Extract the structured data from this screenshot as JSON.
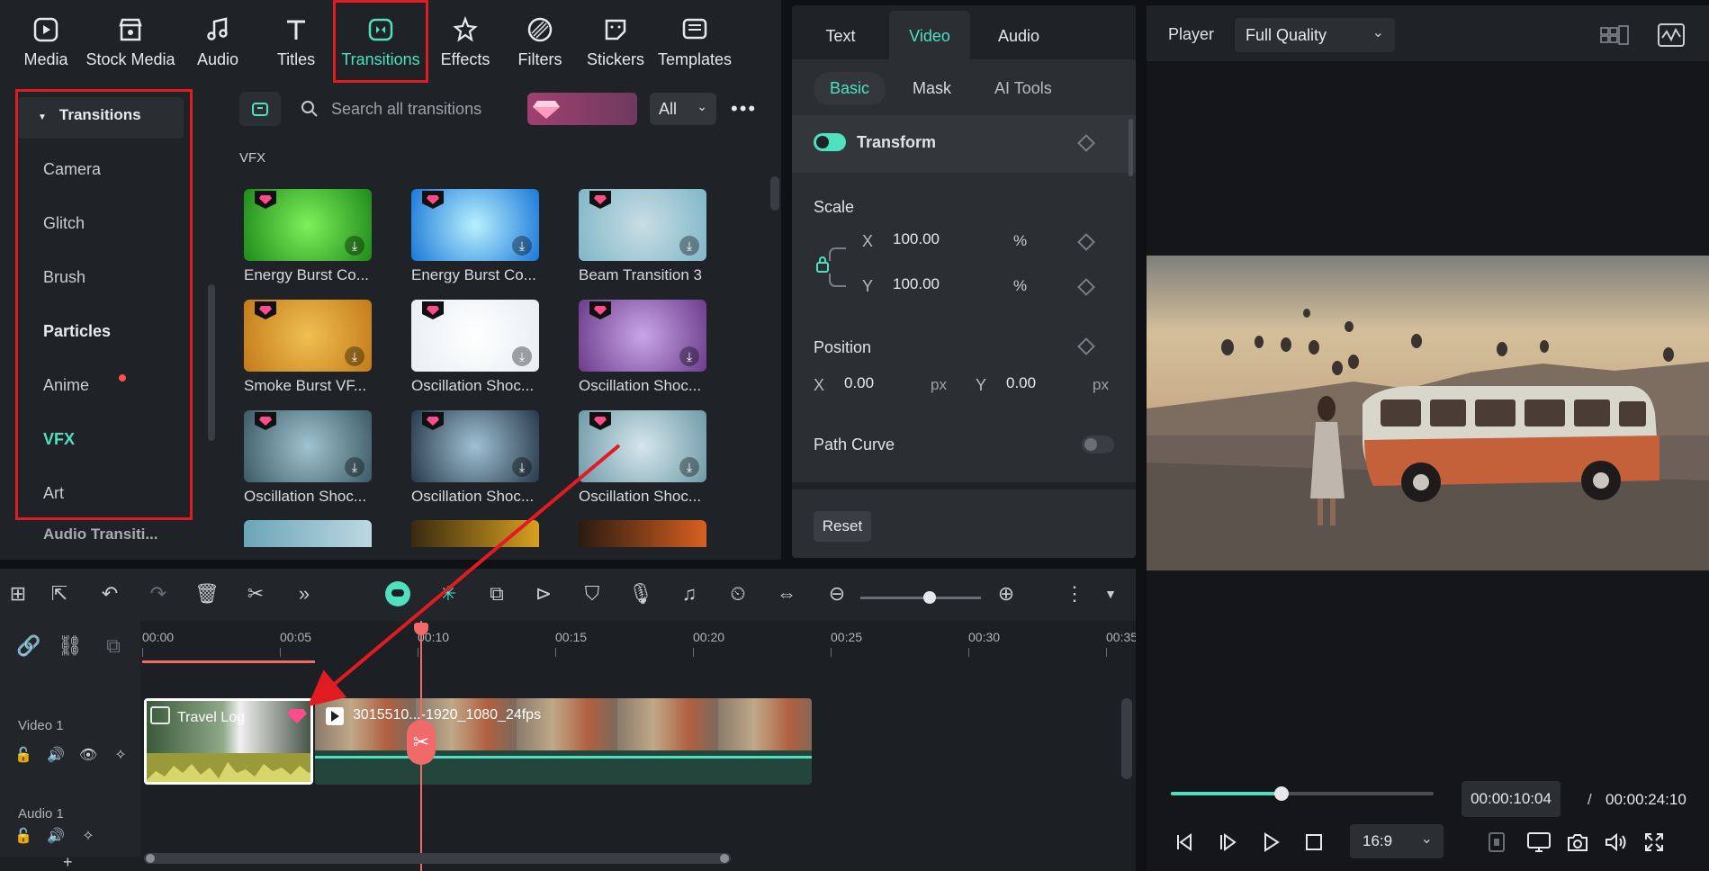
{
  "toolbar": {
    "items": [
      {
        "label": "Media",
        "icon": "media-icon"
      },
      {
        "label": "Stock Media",
        "icon": "stock-media-icon"
      },
      {
        "label": "Audio",
        "icon": "audio-icon"
      },
      {
        "label": "Titles",
        "icon": "titles-icon"
      },
      {
        "label": "Transitions",
        "icon": "transitions-icon"
      },
      {
        "label": "Effects",
        "icon": "effects-icon"
      },
      {
        "label": "Filters",
        "icon": "filters-icon"
      },
      {
        "label": "Stickers",
        "icon": "stickers-icon"
      },
      {
        "label": "Templates",
        "icon": "templates-icon"
      }
    ],
    "active": "Transitions"
  },
  "categories": {
    "header": "Transitions",
    "items": [
      "Camera",
      "Glitch",
      "Brush",
      "Particles",
      "Anime",
      "VFX",
      "Art"
    ],
    "footer": "Audio Transiti..."
  },
  "search": {
    "placeholder": "Search all transitions",
    "filter": "All"
  },
  "section_title": "VFX",
  "thumbnails": [
    {
      "label": "Energy Burst Co...",
      "colors": [
        "#1e8a1a",
        "#7ef05a"
      ]
    },
    {
      "label": "Energy Burst Co...",
      "colors": [
        "#1a78d8",
        "#b8f0ff"
      ]
    },
    {
      "label": "Beam Transition 3",
      "colors": [
        "#7fb7c9",
        "#c9dde4"
      ]
    },
    {
      "label": "Smoke Burst VF...",
      "colors": [
        "#c47a1a",
        "#f0c050"
      ]
    },
    {
      "label": "Oscillation Shoc...",
      "colors": [
        "#e8eef2",
        "#ffffff"
      ]
    },
    {
      "label": "Oscillation Shoc...",
      "colors": [
        "#6b3c8a",
        "#c9a5e8"
      ]
    },
    {
      "label": "Oscillation Shoc...",
      "colors": [
        "#3c5a66",
        "#9fc4cf"
      ]
    },
    {
      "label": "Oscillation Shoc...",
      "colors": [
        "#263a4a",
        "#a0c0d4"
      ]
    },
    {
      "label": "Oscillation Shoc...",
      "colors": [
        "#6f9aa8",
        "#d5e6ec"
      ]
    }
  ],
  "properties": {
    "tabs": [
      "Text",
      "Video",
      "Audio"
    ],
    "active_tab": "Video",
    "subtabs": [
      "Basic",
      "Mask",
      "AI Tools"
    ],
    "active_subtab": "Basic",
    "transform_label": "Transform",
    "scale_label": "Scale",
    "scale_x": "100.00",
    "scale_y": "100.00",
    "x_label": "X",
    "y_label": "Y",
    "percent": "%",
    "position_label": "Position",
    "pos_x": "0.00",
    "pos_y": "0.00",
    "px": "px",
    "path_curve_label": "Path Curve",
    "reset_label": "Reset"
  },
  "player": {
    "label": "Player",
    "quality": "Full Quality",
    "current_time": "00:00:10:04",
    "separator": "/",
    "total_time": "00:00:24:10",
    "aspect": "16:9",
    "progress": 0.42
  },
  "timeline": {
    "ticks": [
      "00:00",
      "00:05",
      "00:10",
      "00:15",
      "00:20",
      "00:25",
      "00:30",
      "00:35"
    ],
    "tracks": {
      "video": "Video 1",
      "audio": "Audio 1"
    },
    "clip1_title": "Travel Log",
    "clip2_title": "3015510...-1920_1080_24fps"
  },
  "colors": {
    "accent": "#4fe0c0",
    "highlight": "#e01b22",
    "playhead": "#f06a6a"
  }
}
